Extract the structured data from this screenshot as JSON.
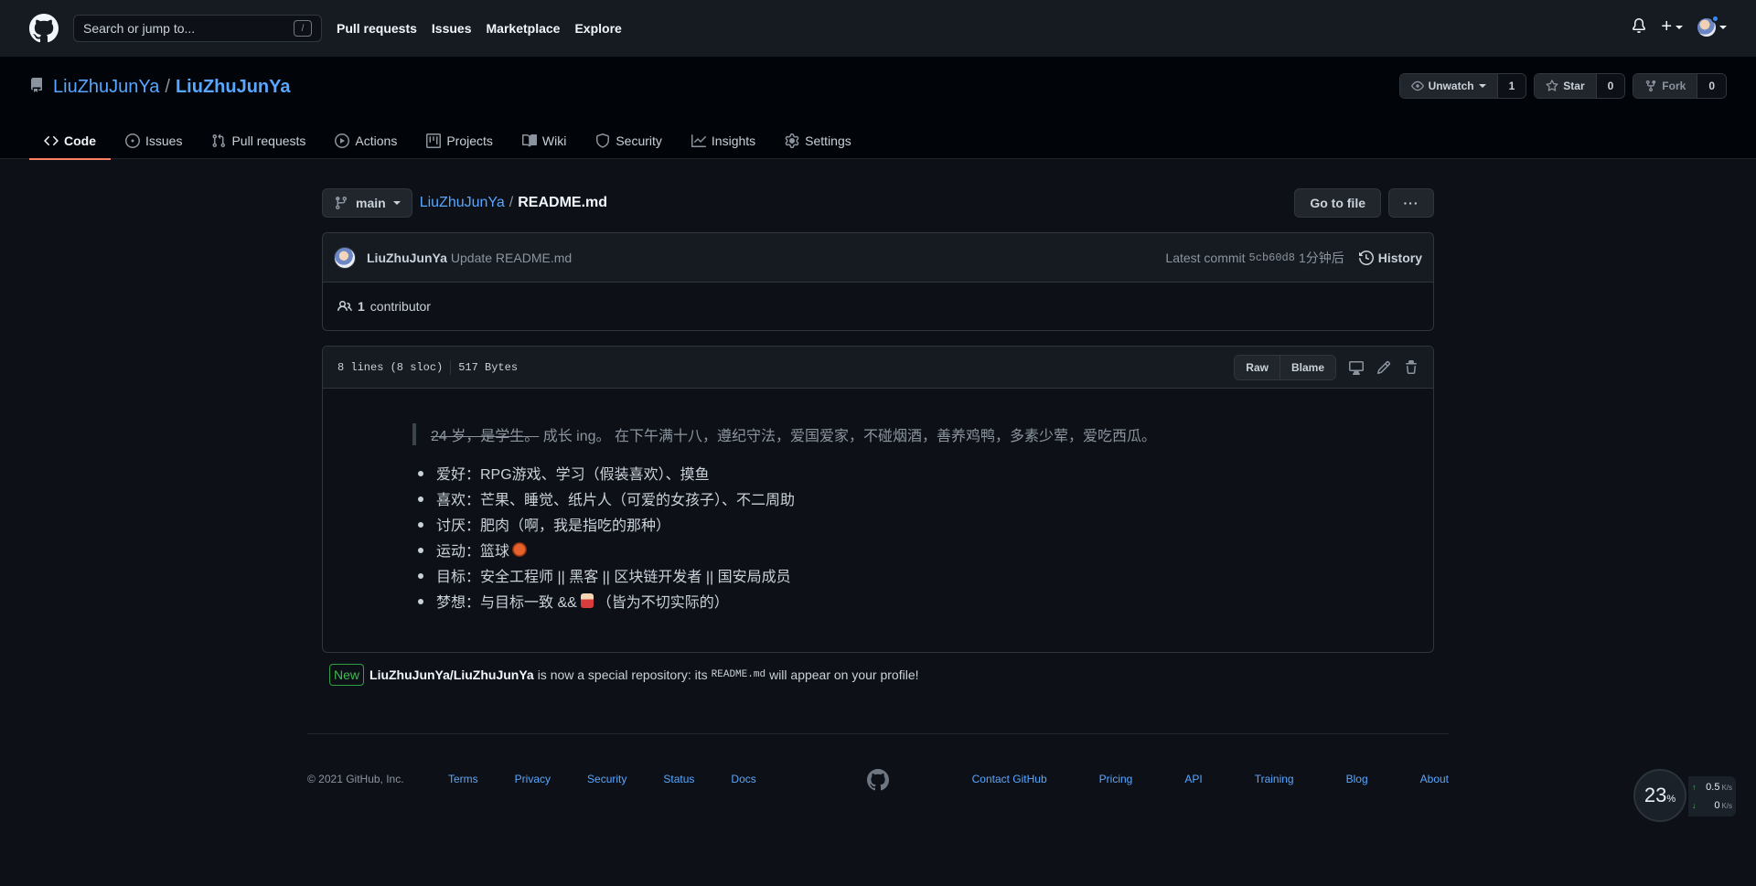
{
  "header": {
    "search_placeholder": "Search or jump to...",
    "slash_key": "/",
    "nav": [
      "Pull requests",
      "Issues",
      "Marketplace",
      "Explore"
    ]
  },
  "repo": {
    "owner": "LiuZhuJunYa",
    "separator": "/",
    "name": "LiuZhuJunYa",
    "watch_label": "Unwatch",
    "watch_count": "1",
    "star_label": "Star",
    "star_count": "0",
    "fork_label": "Fork",
    "fork_count": "0",
    "tabs": [
      {
        "label": "Code",
        "icon": "code-icon"
      },
      {
        "label": "Issues",
        "icon": "issue-icon"
      },
      {
        "label": "Pull requests",
        "icon": "pull-request-icon"
      },
      {
        "label": "Actions",
        "icon": "play-icon"
      },
      {
        "label": "Projects",
        "icon": "project-icon"
      },
      {
        "label": "Wiki",
        "icon": "book-icon"
      },
      {
        "label": "Security",
        "icon": "shield-icon"
      },
      {
        "label": "Insights",
        "icon": "graph-icon"
      },
      {
        "label": "Settings",
        "icon": "gear-icon"
      }
    ]
  },
  "filenav": {
    "branch": "main",
    "crumb_repo": "LiuZhuJunYa",
    "crumb_sep": "/",
    "crumb_file": "README.md",
    "go_to_file": "Go to file",
    "more": "···"
  },
  "commit": {
    "author": "LiuZhuJunYa",
    "message": "Update README.md",
    "latest_label": "Latest commit",
    "sha": "5cb60d8",
    "time": "1分钟后",
    "history": "History",
    "contributors_count": "1",
    "contributors_label": "contributor"
  },
  "file": {
    "lines": "8 lines (8 sloc)",
    "size": "517 Bytes",
    "raw": "Raw",
    "blame": "Blame"
  },
  "readme": {
    "quote_struck": "24 岁，是学生。",
    "quote_rest": "成长 ing。 在下午满十八，遵纪守法，爱国爱家，不碰烟酒，善养鸡鸭，多素少荤，爱吃西瓜。",
    "items": [
      "爱好：RPG游戏、学习（假装喜欢）、摸鱼",
      "喜欢：芒果、睡觉、纸片人（可爱的女孩子）、不二周助",
      "讨厌：肥肉（啊，我是指吃的那种）",
      "运动：篮球",
      "目标：安全工程师 || 黑客 || 区块链开发者 || 国安局成员",
      "梦想：与目标一致 &&",
      "（皆为不切实际的）"
    ]
  },
  "notice": {
    "badge": "New",
    "repo": "LiuZhuJunYa/LiuZhuJunYa",
    "text1": "is now a special repository: its",
    "code": "README.md",
    "text2": "will appear on your profile!"
  },
  "footer": {
    "copyright": "© 2021 GitHub, Inc.",
    "left_links": [
      "Terms",
      "Privacy",
      "Security",
      "Status",
      "Docs"
    ],
    "right_links": [
      "Contact GitHub",
      "Pricing",
      "API",
      "Training",
      "Blog",
      "About"
    ]
  },
  "net_widget": {
    "percent": "23",
    "percent_sign": "%",
    "up": "0.5",
    "down": "0",
    "unit": "K/s"
  }
}
